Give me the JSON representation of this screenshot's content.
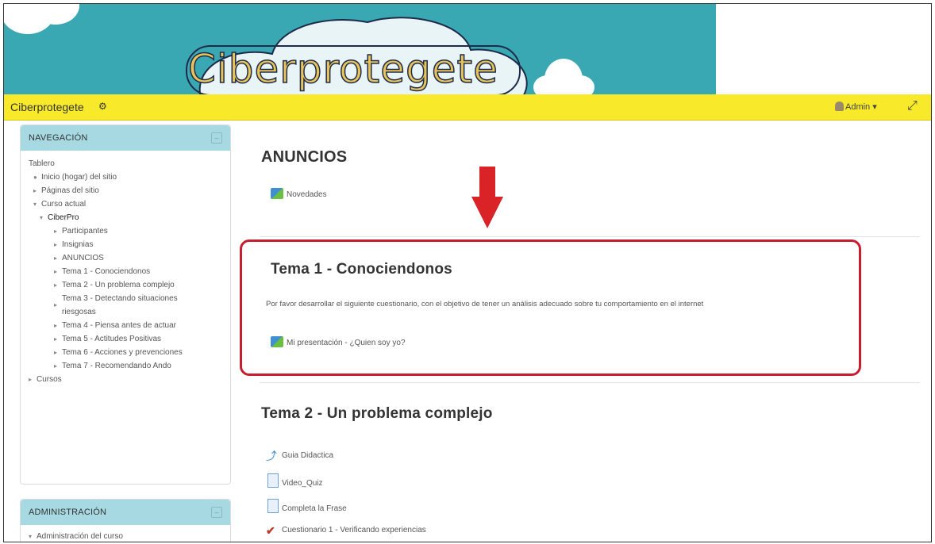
{
  "banner": {
    "title": "Ciberprotegete"
  },
  "navbar": {
    "brand": "Ciberprotegete",
    "brand_icon": "⚙",
    "user_label": "Admin ▾",
    "expand_icon": "⤢"
  },
  "navigation": {
    "title": "NAVEGACIÓN",
    "toggle": "–",
    "items": [
      {
        "label": "Tablero"
      },
      {
        "label": "Inicio (hogar) del sitio",
        "marker": "●"
      },
      {
        "label": "Páginas del sitio",
        "marker": "▸"
      },
      {
        "label": "Curso actual",
        "marker": "▾"
      },
      {
        "label": "CiberPro",
        "marker": "▾"
      },
      {
        "label": "Participantes",
        "marker": "▸"
      },
      {
        "label": "Insignias",
        "marker": "▸"
      },
      {
        "label": "ANUNCIOS",
        "marker": "▸"
      },
      {
        "label": "Tema 1 - Conociendonos",
        "marker": "▸"
      },
      {
        "label": "Tema 2 - Un problema complejo",
        "marker": "▸"
      },
      {
        "label": "Tema 3 - Detectando situaciones riesgosas",
        "marker": "▸"
      },
      {
        "label": "Tema 4 - Piensa antes de actuar",
        "marker": "▸"
      },
      {
        "label": "Tema 5 - Actitudes Positivas",
        "marker": "▸"
      },
      {
        "label": "Tema 6 - Acciones y prevenciones",
        "marker": "▸"
      },
      {
        "label": "Tema 7 - Recomendando Ando",
        "marker": "▸"
      },
      {
        "label": "Cursos",
        "marker": "▸"
      }
    ]
  },
  "administration": {
    "title": "ADMINISTRACIÓN",
    "toggle": "–",
    "items": [
      {
        "label": "Administración del curso",
        "marker": "▾"
      }
    ]
  },
  "main": {
    "anuncios": {
      "title": "ANUNCIOS",
      "activity": "Novedades"
    },
    "tema1": {
      "title": "Tema 1 - Conociendonos",
      "description": "Por favor desarrollar el siguiente cuestionario, con el objetivo de tener un análisis adecuado sobre tu comportamiento en el internet",
      "activity": "Mi presentación - ¿Quien soy yo?"
    },
    "tema2": {
      "title": "Tema 2 - Un problema complejo",
      "activities": [
        {
          "label": "Guia Didactica",
          "icon": "url-icon"
        },
        {
          "label": "Video_Quiz",
          "icon": "page-icon"
        },
        {
          "label": "Completa la Frase",
          "icon": "page-icon"
        },
        {
          "label": "Cuestionario 1 - Verificando experiencias",
          "icon": "quiz-icon"
        }
      ]
    }
  },
  "colors": {
    "banner": "#3aa8b2",
    "navbar": "#f8ea2a",
    "block_header": "#a7d9e2",
    "highlight": "#c81d2f"
  }
}
